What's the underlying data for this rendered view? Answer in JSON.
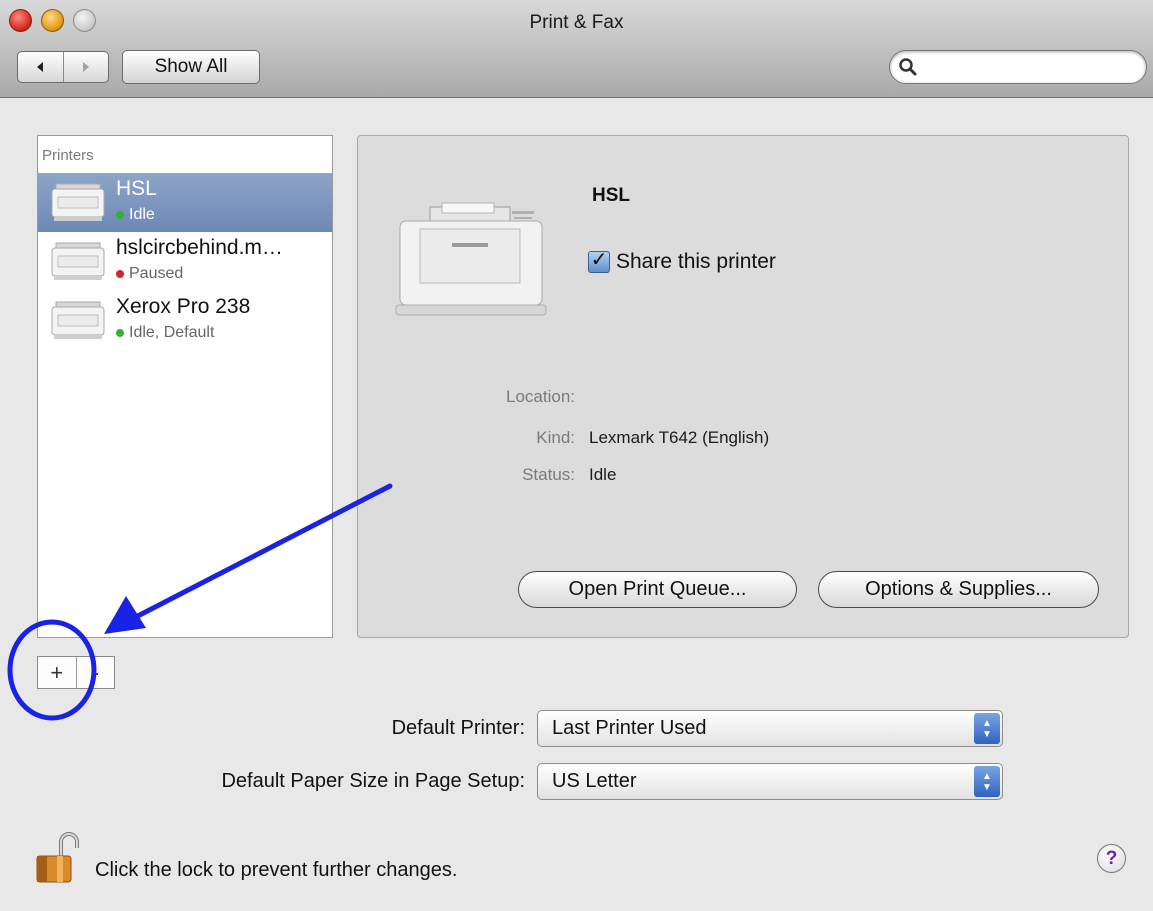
{
  "window": {
    "title": "Print & Fax"
  },
  "toolbar": {
    "back_icon": "back-arrow-icon",
    "forward_icon": "forward-arrow-icon",
    "show_all_label": "Show All",
    "search_icon": "magnifier-icon",
    "search_placeholder": ""
  },
  "printers": {
    "header": "Printers",
    "items": [
      {
        "name": "HSL",
        "status": "Idle",
        "status_color": "#31b12f",
        "selected": true
      },
      {
        "name": "hslcircbehind.m…",
        "status": "Paused",
        "status_color": "#d9232b",
        "selected": false
      },
      {
        "name": "Xerox Pro 238",
        "status": "Idle, Default",
        "status_color": "#31b12f",
        "selected": false
      }
    ],
    "add_label": "+",
    "remove_label": "-"
  },
  "detail": {
    "name": "HSL",
    "share_label": "Share this printer",
    "share_checked": true,
    "location_label": "Location:",
    "location_value": "",
    "kind_label": "Kind:",
    "kind_value": "Lexmark T642 (English)",
    "status_label": "Status:",
    "status_value": "Idle",
    "open_queue_label": "Open Print Queue...",
    "options_label": "Options & Supplies..."
  },
  "defaults": {
    "printer_label": "Default Printer:",
    "printer_value": "Last Printer Used",
    "paper_label": "Default Paper Size in Page Setup:",
    "paper_value": "US Letter"
  },
  "footer": {
    "lock_text": "Click the lock to prevent further changes.",
    "help_label": "?"
  },
  "colors": {
    "selection": "#7891bd",
    "annotation": "#1a22e6"
  }
}
